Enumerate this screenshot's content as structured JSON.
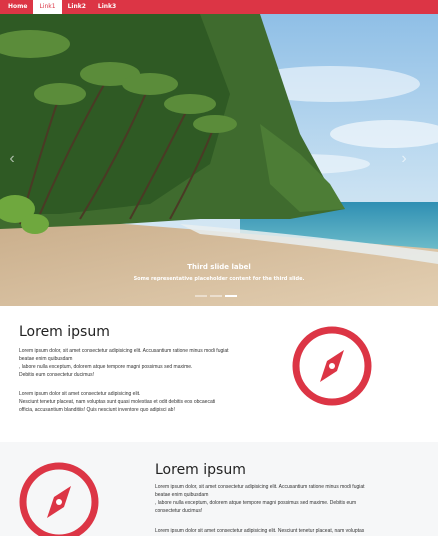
{
  "nav": {
    "items": [
      {
        "label": "Home",
        "active": false
      },
      {
        "label": "Link1",
        "active": true
      },
      {
        "label": "Link2",
        "active": false
      },
      {
        "label": "Link3",
        "active": false
      }
    ],
    "color": "#dc3545"
  },
  "carousel": {
    "caption_title": "Third slide label",
    "caption_text": "Some representative placeholder content for the third slide.",
    "indicators": 3,
    "active_index": 2,
    "prev_icon": "chevron-left-icon",
    "next_icon": "chevron-right-icon"
  },
  "features": [
    {
      "heading": "Lorem ipsum",
      "p1_line1": "Lorem ipsum dolor, sit amet consectetur adipisicing elit. Accusantium ratione minus modi fugiat",
      "p1_line2": "beatae enim quibusdam",
      "p1_line3": ", labore nulla exceptum, dolorem atque tempore magni possimus sed maxime.",
      "p1_line4": "Debitis eum consectetur ducimus!",
      "p2_line1": "Lorem ipsum dolor sit amet consectetur adipisicing elit.",
      "p2_line2": "Nesciunt tenetur placeat, nam voluptas sunt quasi molestias et odit debitis eos obcaecati",
      "p2_line3": "officia, accusantium blanditiis! Quis nesciunt inventore quo adipisci ab!",
      "icon": "compass-icon"
    },
    {
      "heading": "Lorem ipsum",
      "p1_line1": "Lorem ipsum dolor, sit amet consectetur adipisicing elit. Accusantium ratione minus modi fugiat",
      "p1_line2": "beatae enim quibusdam",
      "p1_line3": ", labore nulla exceptum, dolorem atque tempore magni possimus sed maxime. Debitis eum",
      "p1_line4": "consectetur ducimus!",
      "p2_line1": "Lorem ipsum dolor sit amet consectetur adipisicing elit. Nesciunt tenetur placeat, nam voluptas",
      "icon": "compass-icon"
    }
  ]
}
